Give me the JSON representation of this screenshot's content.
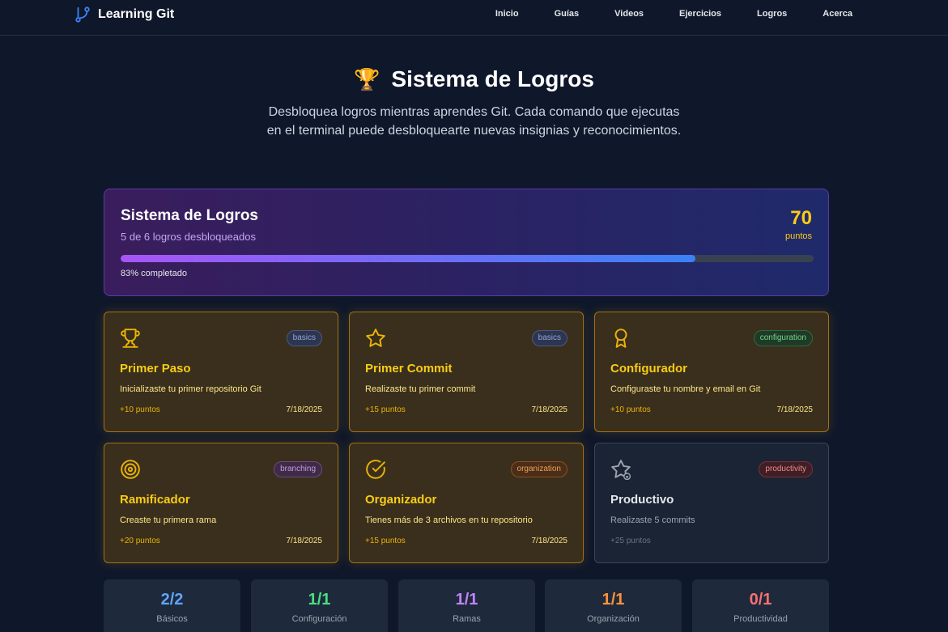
{
  "nav": {
    "brand": "Learning Git",
    "links": [
      "Inicio",
      "Guías",
      "Videos",
      "Ejercicios",
      "Logros",
      "Acerca"
    ]
  },
  "hero": {
    "icon": "trophy-icon",
    "title": "Sistema de Logros",
    "description": "Desbloquea logros mientras aprendes Git. Cada comando que ejecutas en el terminal puede desbloquearte nuevas insignias y reconocimientos."
  },
  "summary": {
    "title": "Sistema de Logros",
    "subtitle": "5 de 6 logros desbloqueados",
    "points": "70",
    "points_label": "puntos",
    "progress_fraction": 0.83,
    "progress_label": "83% completado"
  },
  "achievements": [
    {
      "icon": "trophy-icon",
      "badge": "basics",
      "title": "Primer Paso",
      "desc": "Inicializaste tu primer repositorio Git",
      "points": "+10 puntos",
      "date": "7/18/2025",
      "unlocked": true
    },
    {
      "icon": "star-icon",
      "badge": "basics",
      "title": "Primer Commit",
      "desc": "Realizaste tu primer commit",
      "points": "+15 puntos",
      "date": "7/18/2025",
      "unlocked": true
    },
    {
      "icon": "award-icon",
      "badge": "configuration",
      "title": "Configurador",
      "desc": "Configuraste tu nombre y email en Git",
      "points": "+10 puntos",
      "date": "7/18/2025",
      "unlocked": true
    },
    {
      "icon": "target-icon",
      "badge": "branching",
      "title": "Ramificador",
      "desc": "Creaste tu primera rama",
      "points": "+20 puntos",
      "date": "7/18/2025",
      "unlocked": true
    },
    {
      "icon": "check-circle-icon",
      "badge": "organization",
      "title": "Organizador",
      "desc": "Tienes más de 3 archivos en tu repositorio",
      "points": "+15 puntos",
      "date": "7/18/2025",
      "unlocked": true
    },
    {
      "icon": "star-locked-icon",
      "badge": "productivity",
      "title": "Productivo",
      "desc": "Realizaste 5 commits",
      "points": "+25 puntos",
      "date": "",
      "unlocked": false
    }
  ],
  "stats": [
    {
      "value": "2/2",
      "label": "Básicos",
      "color": "#60a5fa"
    },
    {
      "value": "1/1",
      "label": "Configuración",
      "color": "#4ade80"
    },
    {
      "value": "1/1",
      "label": "Ramas",
      "color": "#c084fc"
    },
    {
      "value": "1/1",
      "label": "Organización",
      "color": "#fb923c"
    },
    {
      "value": "0/1",
      "label": "Productividad",
      "color": "#f87171"
    }
  ]
}
